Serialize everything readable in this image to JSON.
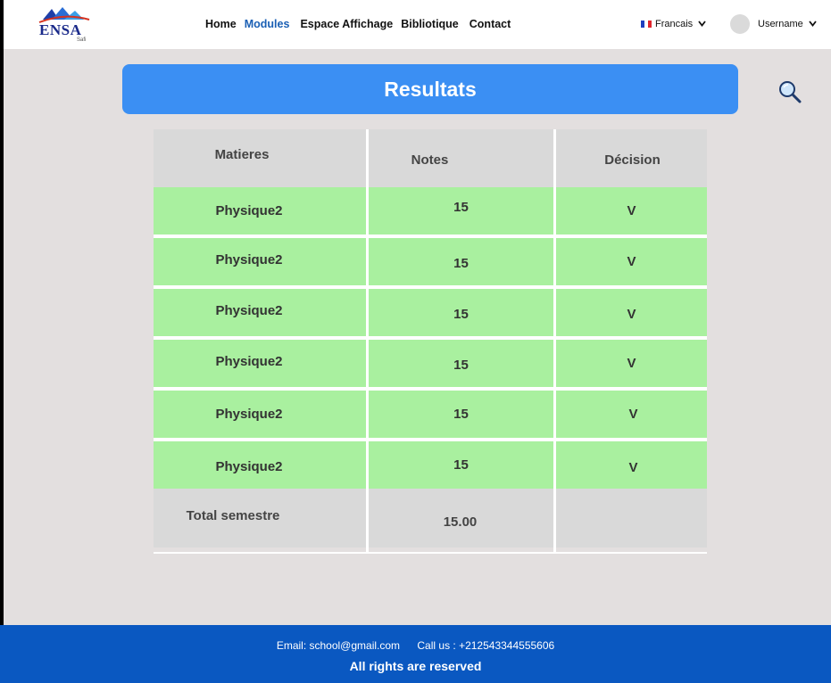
{
  "header": {
    "logo_text": "ENSA",
    "logo_subtext": "Safi",
    "nav": [
      {
        "label": "Home",
        "active": false
      },
      {
        "label": "Modules",
        "active": true
      },
      {
        "label": "Espace Affichage",
        "active": false
      },
      {
        "label": "Bibliotique",
        "active": false
      },
      {
        "label": "Contact",
        "active": false
      }
    ],
    "language": "Francais",
    "username": "Username"
  },
  "page": {
    "title": "Resultats"
  },
  "table": {
    "columns": [
      "Matieres",
      "Notes",
      "Décision"
    ],
    "rows": [
      {
        "matiere": "Physique2",
        "note": "15",
        "decision": "V"
      },
      {
        "matiere": "Physique2",
        "note": "15",
        "decision": "V"
      },
      {
        "matiere": "Physique2",
        "note": "15",
        "decision": "V"
      },
      {
        "matiere": "Physique2",
        "note": "15",
        "decision": "V"
      },
      {
        "matiere": "Physique2",
        "note": "15",
        "decision": "V"
      },
      {
        "matiere": "Physique2",
        "note": "15",
        "decision": "V"
      }
    ],
    "total": {
      "label": "Total semestre",
      "note": "15.00",
      "decision": ""
    }
  },
  "footer": {
    "email": "Email: school@gmail.com",
    "phone": "Call us : +212543344555606",
    "rights": "All rights are reserved"
  },
  "colors": {
    "accent": "#3b8ff3",
    "footer": "#0a58c1",
    "row_pass": "#a9f09f",
    "header_cell": "#d9d9d9",
    "background": "#e3dfdf"
  },
  "icons": {
    "search": "search-icon",
    "chevron": "chevron-down-icon",
    "flag": "flag-fr-icon"
  }
}
